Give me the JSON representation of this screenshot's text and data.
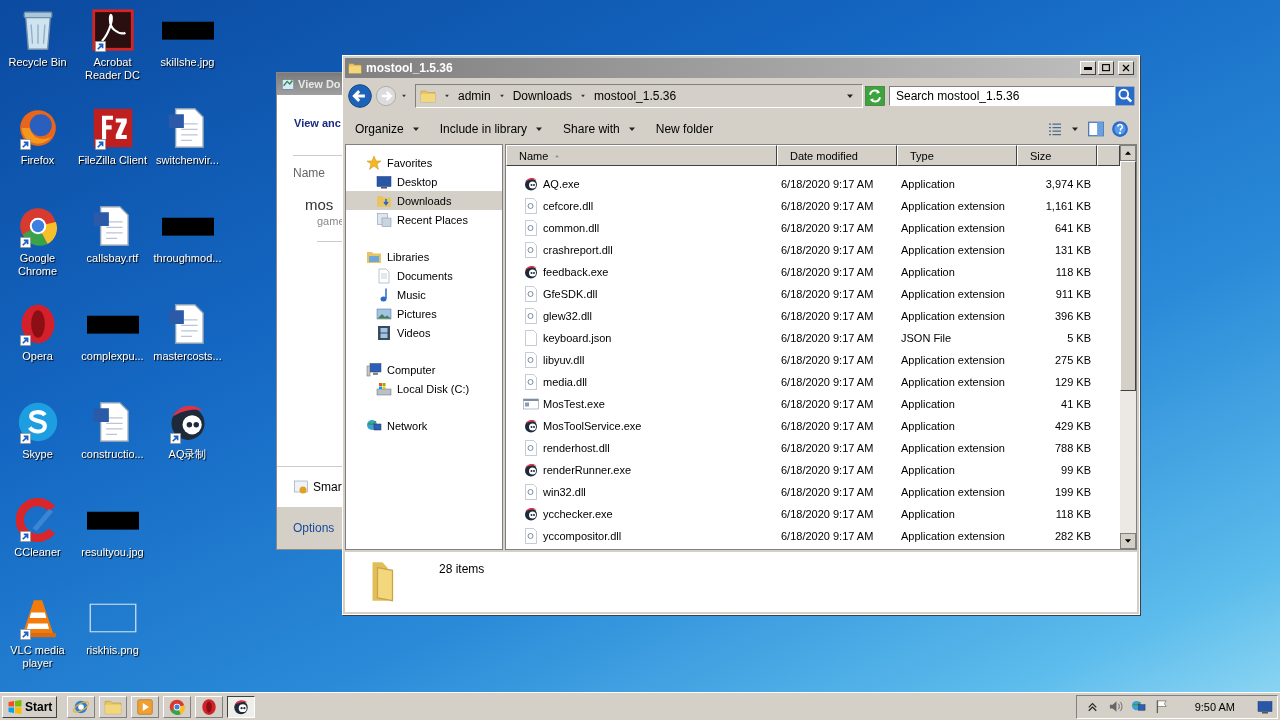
{
  "desktop": {
    "icons": [
      {
        "label": "Recycle Bin",
        "kind": "recycle",
        "shortcut": false
      },
      {
        "label": "Firefox",
        "kind": "firefox",
        "shortcut": true
      },
      {
        "label": "Google Chrome",
        "kind": "chrome",
        "shortcut": true
      },
      {
        "label": "Opera",
        "kind": "opera",
        "shortcut": true
      },
      {
        "label": "Skype",
        "kind": "skype",
        "shortcut": true
      },
      {
        "label": "CCleaner",
        "kind": "ccleaner",
        "shortcut": true
      },
      {
        "label": "VLC media player",
        "kind": "vlc",
        "shortcut": true
      },
      {
        "label": "Acrobat Reader DC",
        "kind": "acrobat",
        "shortcut": true
      },
      {
        "label": "FileZilla Client",
        "kind": "filezilla",
        "shortcut": true
      },
      {
        "label": "callsbay.rtf",
        "kind": "word",
        "shortcut": false
      },
      {
        "label": "complexpu...",
        "kind": "thumb",
        "shortcut": false
      },
      {
        "label": "constructio...",
        "kind": "word",
        "shortcut": false
      },
      {
        "label": "resultyou.jpg",
        "kind": "thumb",
        "shortcut": false
      },
      {
        "label": "riskhis.png",
        "kind": "blank",
        "shortcut": false
      },
      {
        "label": "skillshe.jpg",
        "kind": "thumb",
        "shortcut": false
      },
      {
        "label": "switchenvir...",
        "kind": "word",
        "shortcut": false
      },
      {
        "label": "throughmod...",
        "kind": "thumb",
        "shortcut": false
      },
      {
        "label": "mastercosts...",
        "kind": "word",
        "shortcut": false
      },
      {
        "label": "AQ录制",
        "kind": "aq",
        "shortcut": true
      }
    ]
  },
  "background_window": {
    "title": "View Do",
    "heading": "View anc",
    "column": "Name",
    "item_name": "mos",
    "item_detail": "game",
    "footer_item": "Smar",
    "footer_link": "Options"
  },
  "explorer": {
    "title": "mostool_1.5.36",
    "breadcrumb": [
      "admin",
      "Downloads",
      "mostool_1.5.36"
    ],
    "search": {
      "placeholder": "Search mostool_1.5.36"
    },
    "toolbar": [
      {
        "label": "Organize",
        "dropdown": true
      },
      {
        "label": "Include in library",
        "dropdown": true
      },
      {
        "label": "Share with",
        "dropdown": true
      },
      {
        "label": "New folder",
        "dropdown": false
      }
    ],
    "nav": [
      {
        "label": "Favorites",
        "kind": "star",
        "selected": false,
        "children": [
          {
            "label": "Desktop",
            "kind": "desktop",
            "selected": false
          },
          {
            "label": "Downloads",
            "kind": "downloads",
            "selected": true
          },
          {
            "label": "Recent Places",
            "kind": "recent",
            "selected": false
          }
        ]
      },
      {
        "label": "Libraries",
        "kind": "libraries",
        "selected": false,
        "children": [
          {
            "label": "Documents",
            "kind": "documents",
            "selected": false
          },
          {
            "label": "Music",
            "kind": "music",
            "selected": false
          },
          {
            "label": "Pictures",
            "kind": "pictures",
            "selected": false
          },
          {
            "label": "Videos",
            "kind": "videos",
            "selected": false
          }
        ]
      },
      {
        "label": "Computer",
        "kind": "computer",
        "selected": false,
        "children": [
          {
            "label": "Local Disk (C:)",
            "kind": "disk",
            "selected": false
          }
        ]
      },
      {
        "label": "Network",
        "kind": "network",
        "selected": false
      }
    ],
    "columns": [
      {
        "label": "Name",
        "sorted": true
      },
      {
        "label": "Date modified",
        "sorted": false
      },
      {
        "label": "Type",
        "sorted": false
      },
      {
        "label": "Size",
        "sorted": false
      }
    ],
    "rows": [
      {
        "name": "AQ.exe",
        "kind": "aq",
        "date": "6/18/2020 9:17 AM",
        "type": "Application",
        "size": "3,974 KB"
      },
      {
        "name": "cefcore.dll",
        "kind": "dll",
        "date": "6/18/2020 9:17 AM",
        "type": "Application extension",
        "size": "1,161 KB"
      },
      {
        "name": "common.dll",
        "kind": "dll",
        "date": "6/18/2020 9:17 AM",
        "type": "Application extension",
        "size": "641 KB"
      },
      {
        "name": "crashreport.dll",
        "kind": "dll",
        "date": "6/18/2020 9:17 AM",
        "type": "Application extension",
        "size": "131 KB"
      },
      {
        "name": "feedback.exe",
        "kind": "aq",
        "date": "6/18/2020 9:17 AM",
        "type": "Application",
        "size": "118 KB"
      },
      {
        "name": "GfeSDK.dll",
        "kind": "dll",
        "date": "6/18/2020 9:17 AM",
        "type": "Application extension",
        "size": "911 KB"
      },
      {
        "name": "glew32.dll",
        "kind": "dll",
        "date": "6/18/2020 9:17 AM",
        "type": "Application extension",
        "size": "396 KB"
      },
      {
        "name": "keyboard.json",
        "kind": "json",
        "date": "6/18/2020 9:17 AM",
        "type": "JSON File",
        "size": "5 KB"
      },
      {
        "name": "libyuv.dll",
        "kind": "dll",
        "date": "6/18/2020 9:17 AM",
        "type": "Application extension",
        "size": "275 KB"
      },
      {
        "name": "media.dll",
        "kind": "dll",
        "date": "6/18/2020 9:17 AM",
        "type": "Application extension",
        "size": "129 KB"
      },
      {
        "name": "MosTest.exe",
        "kind": "app",
        "date": "6/18/2020 9:17 AM",
        "type": "Application",
        "size": "41 KB"
      },
      {
        "name": "MosToolService.exe",
        "kind": "aq",
        "date": "6/18/2020 9:17 AM",
        "type": "Application",
        "size": "429 KB"
      },
      {
        "name": "renderhost.dll",
        "kind": "dll",
        "date": "6/18/2020 9:17 AM",
        "type": "Application extension",
        "size": "788 KB"
      },
      {
        "name": "renderRunner.exe",
        "kind": "aq",
        "date": "6/18/2020 9:17 AM",
        "type": "Application",
        "size": "99 KB"
      },
      {
        "name": "win32.dll",
        "kind": "dll",
        "date": "6/18/2020 9:17 AM",
        "type": "Application extension",
        "size": "199 KB"
      },
      {
        "name": "ycchecker.exe",
        "kind": "aq",
        "date": "6/18/2020 9:17 AM",
        "type": "Application",
        "size": "118 KB"
      },
      {
        "name": "yccompositor.dll",
        "kind": "dll",
        "date": "6/18/2020 9:17 AM",
        "type": "Application extension",
        "size": "282 KB"
      }
    ],
    "status": "28 items"
  },
  "taskbar": {
    "start": "Start",
    "apps": [
      {
        "kind": "ie",
        "selected": false
      },
      {
        "kind": "folder",
        "selected": false
      },
      {
        "kind": "media",
        "selected": false
      },
      {
        "kind": "chrome",
        "selected": false
      },
      {
        "kind": "opera",
        "selected": false
      },
      {
        "kind": "aq",
        "selected": true
      }
    ],
    "tray": [
      {
        "kind": "chevron"
      },
      {
        "kind": "speaker"
      },
      {
        "kind": "network"
      },
      {
        "kind": "flag"
      }
    ],
    "clock": "9:50 AM"
  }
}
